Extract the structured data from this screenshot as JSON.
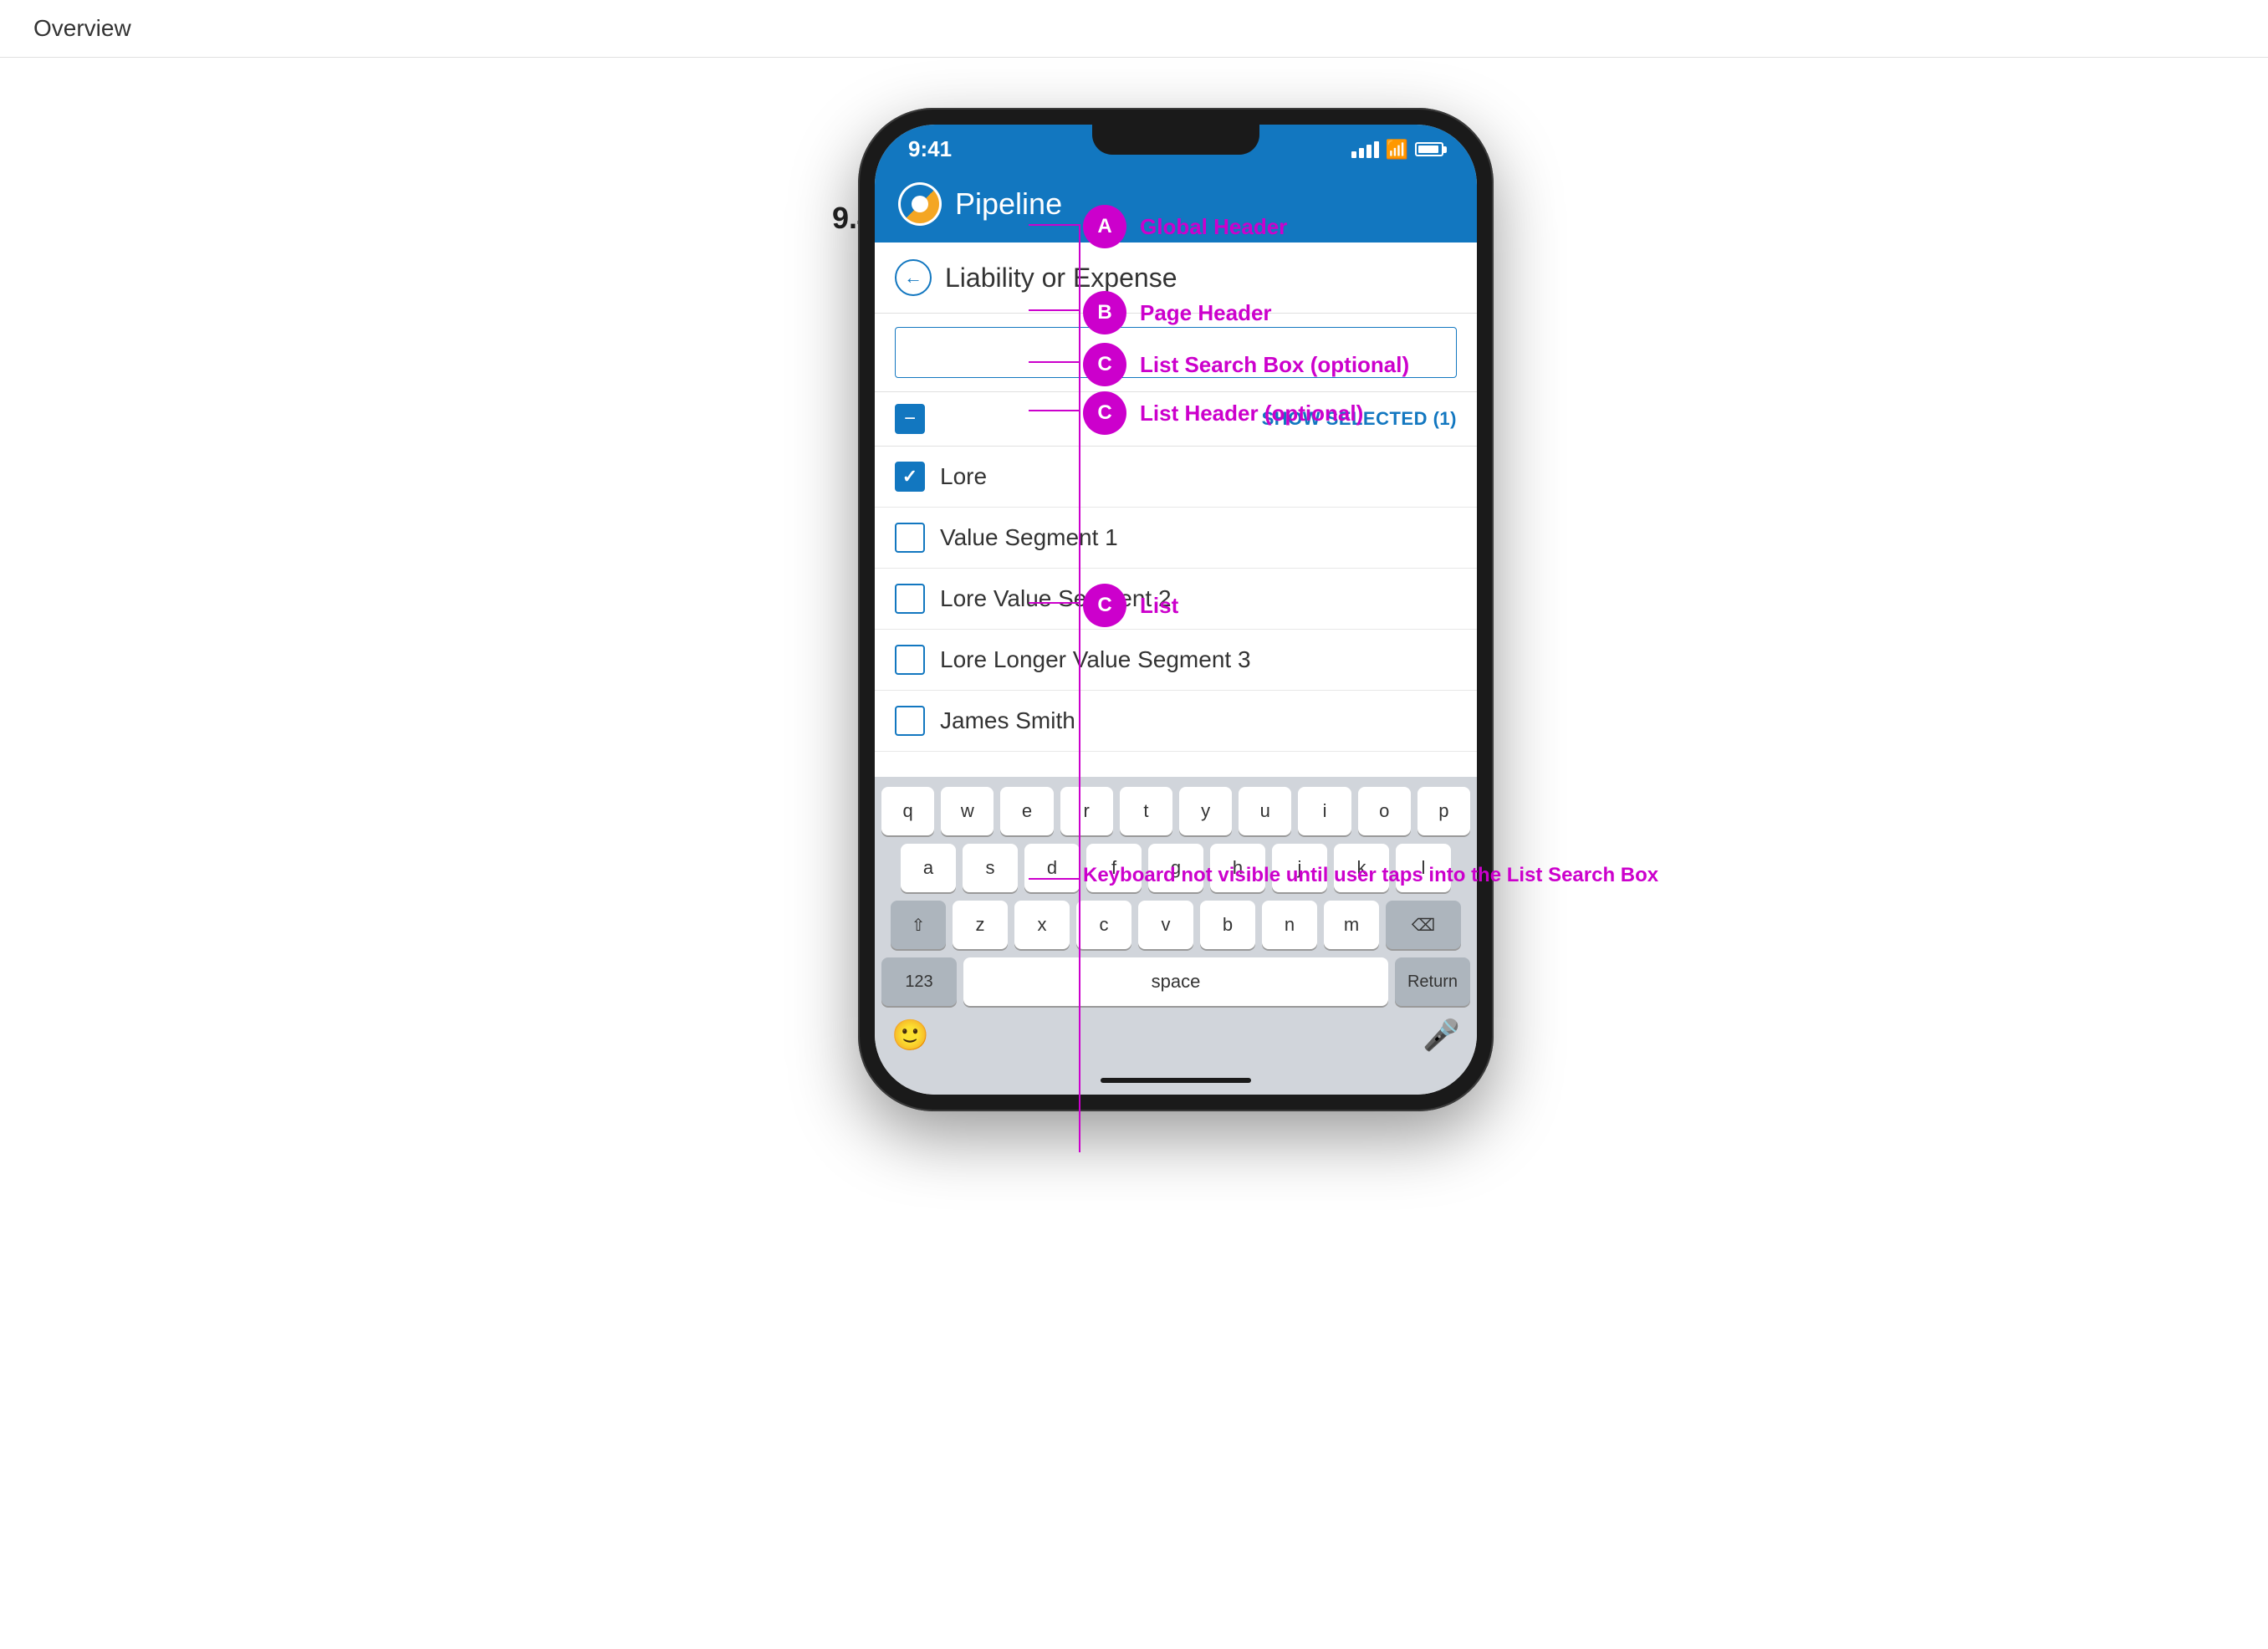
{
  "nav": {
    "title": "Overview"
  },
  "doc_title": "9.41 Pipeline Liability or Expense",
  "phone": {
    "status_bar": {
      "time": "9:41"
    },
    "global_header": {
      "app_name": "Pipeline",
      "label": "Global Header"
    },
    "page_header": {
      "title": "Liability or Expense",
      "label": "Page Header"
    },
    "search_box": {
      "placeholder": "",
      "label": "List Search Box (optional)"
    },
    "list_header": {
      "show_selected_text": "SHOW SELECTED (1)",
      "label": "List Header (optional)"
    },
    "list_items": [
      {
        "id": 1,
        "label": "Lore",
        "checked": true
      },
      {
        "id": 2,
        "label": "Value Segment 1",
        "checked": false
      },
      {
        "id": 3,
        "label": "Lore Value Segment 2",
        "checked": false
      },
      {
        "id": 4,
        "label": "Lore Longer Value Segment 3",
        "checked": false
      },
      {
        "id": 5,
        "label": "James Smith",
        "checked": false
      }
    ],
    "list_label": "List",
    "keyboard": {
      "rows": [
        [
          "q",
          "w",
          "e",
          "r",
          "t",
          "y",
          "u",
          "i",
          "o",
          "p"
        ],
        [
          "a",
          "s",
          "d",
          "f",
          "g",
          "h",
          "j",
          "k",
          "l"
        ],
        [
          "z",
          "x",
          "c",
          "v",
          "b",
          "n",
          "m"
        ]
      ],
      "special": {
        "num": "123",
        "space": "space",
        "return_key": "Return",
        "backspace": "⌫",
        "shift": "⇧"
      }
    },
    "keyboard_note": "Keyboard not visible until user\ntaps into the List Search Box"
  },
  "annotations": {
    "a": "A",
    "b": "B",
    "c": "C",
    "global_header_label": "Global Header",
    "page_header_label": "Page Header",
    "list_search_label": "List Search Box (optional)",
    "list_header_label": "List Header (optional)",
    "list_label": "List",
    "keyboard_note": "Keyboard not visible until user\ntaps into the List Search Box"
  }
}
